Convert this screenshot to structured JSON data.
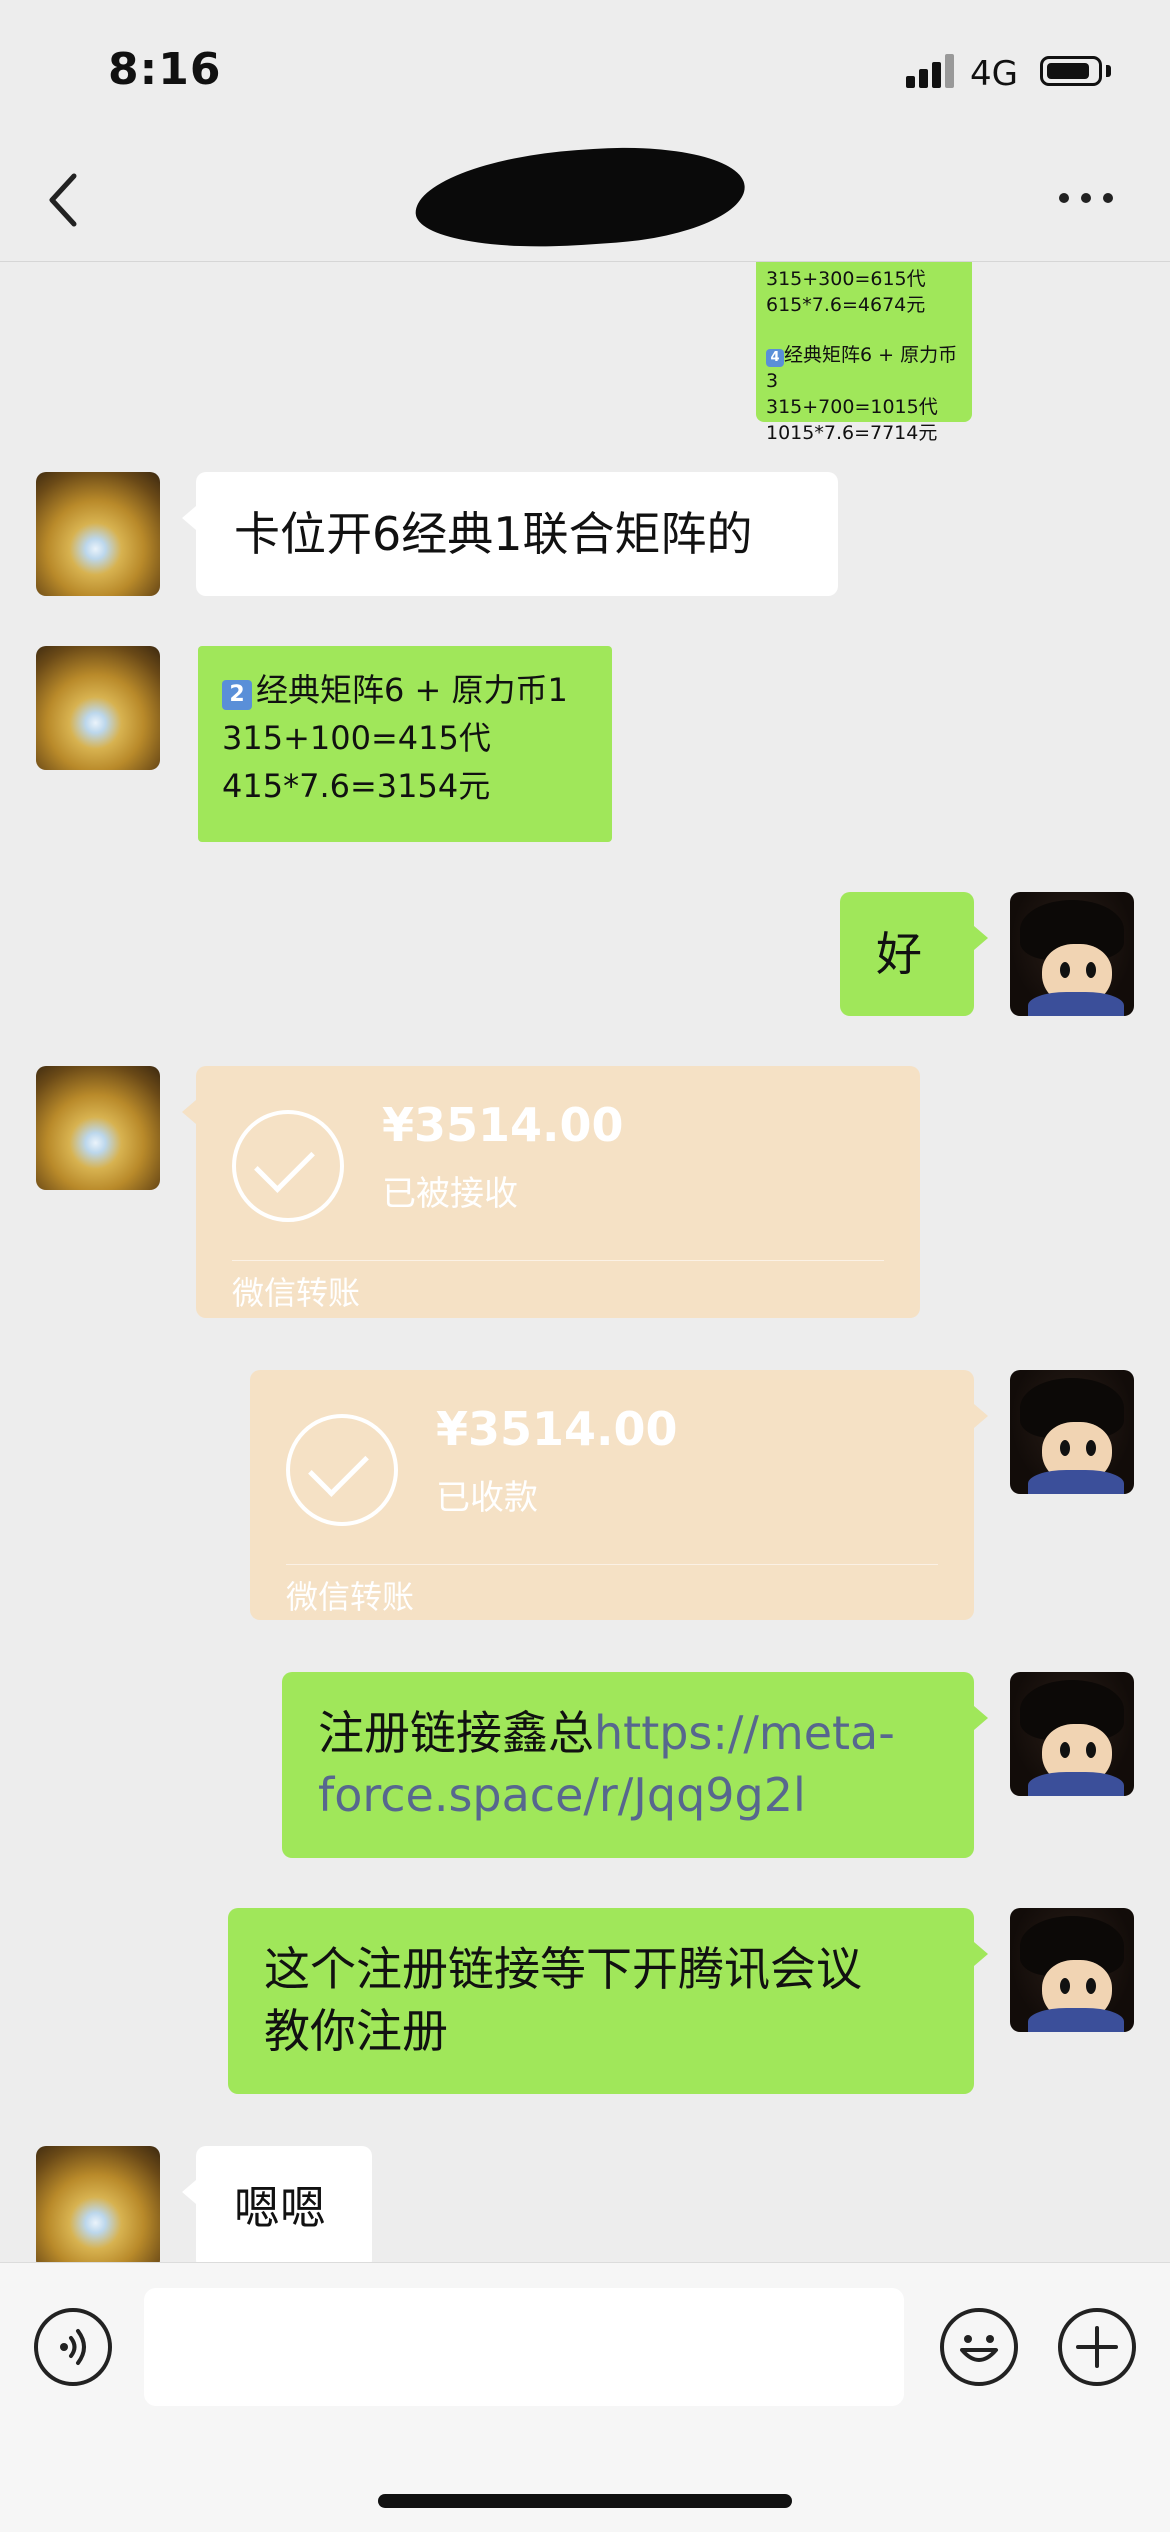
{
  "status_bar": {
    "time": "8:16",
    "network": "4G"
  },
  "nav": {
    "back_icon": "chevron-left-icon",
    "title": "",
    "more_icon": "more-horizontal-icon"
  },
  "messages": {
    "top_partial": {
      "line1": "315+300=615代",
      "line2": "615*7.6=4674元",
      "badge": "4",
      "line3": "经典矩阵6 + 原力币3",
      "line4": "315+700=1015代",
      "line5": "1015*7.6=7714元"
    },
    "m1": {
      "text": "卡位开6经典1联合矩阵的"
    },
    "m2": {
      "badge": "2",
      "line1": "经典矩阵6 + 原力币1",
      "line2": "315+100=415代",
      "line3": "415*7.6=3154元"
    },
    "m3": {
      "text": "好"
    },
    "t1": {
      "amount": "¥3514.00",
      "status": "已被接收",
      "footer": "微信转账"
    },
    "t2": {
      "amount": "¥3514.00",
      "status": "已收款",
      "footer": "微信转账"
    },
    "m4": {
      "text": "注册链接鑫总",
      "link_part1": "https://meta-",
      "link_part2": "force.space/r/Jqq9g2l"
    },
    "m5": {
      "line1": "这个注册链接等下开腾讯会议",
      "line2": "教你注册"
    },
    "m6": {
      "text": "嗯嗯"
    }
  },
  "input_bar": {
    "voice_icon": "voice-icon",
    "emoji_icon": "emoji-icon",
    "plus_icon": "plus-icon",
    "placeholder": ""
  }
}
